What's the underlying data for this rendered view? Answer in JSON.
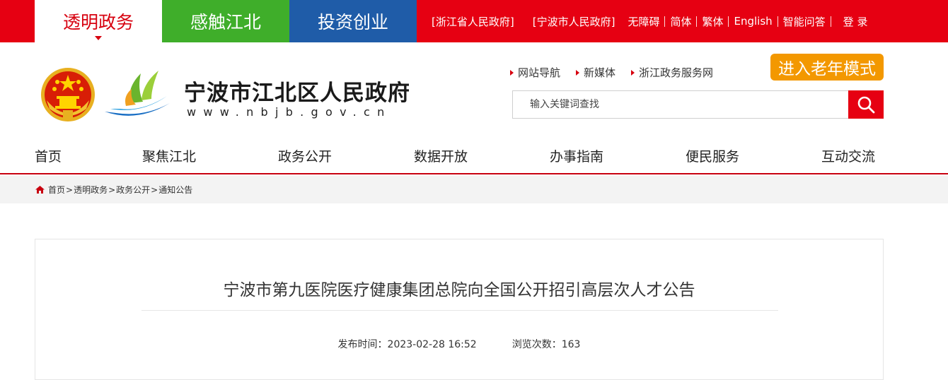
{
  "top_tabs": [
    {
      "label": "透明政务",
      "active": true
    },
    {
      "label": "感触江北",
      "active": false
    },
    {
      "label": "投资创业",
      "active": false
    }
  ],
  "top_links": {
    "zhejiang_gov": "[浙江省人民政府]",
    "ningbo_gov": "[宁波市人民政府]",
    "accessibility": "无障碍",
    "simplified": "简体",
    "traditional": "繁体",
    "english": "English",
    "smart_qa": "智能问答",
    "login": "登 录"
  },
  "header": {
    "site_name": "宁波市江北区人民政府",
    "site_url": "www.nbjb.gov.cn",
    "quick_links": [
      "网站导航",
      "新媒体",
      "浙江政务服务网"
    ],
    "elder_mode": "进入老年模式",
    "search_placeholder": "输入关键词查找"
  },
  "main_nav": [
    "首页",
    "聚焦江北",
    "政务公开",
    "数据开放",
    "办事指南",
    "便民服务",
    "互动交流"
  ],
  "breadcrumb": [
    "首页",
    "透明政务",
    "政务公开",
    "通知公告"
  ],
  "article": {
    "title": "宁波市第九医院医疗健康集团总院向全国公开招引高层次人才公告",
    "publish_label": "发布时间：",
    "publish_time": "2023-02-28 16:52",
    "views_label": "浏览次数：",
    "views": "163"
  },
  "colors": {
    "brand_red": "#e60012",
    "green_tab": "#3fae2a",
    "blue_tab": "#1f5ca8",
    "elder_orange": "#f39800"
  }
}
